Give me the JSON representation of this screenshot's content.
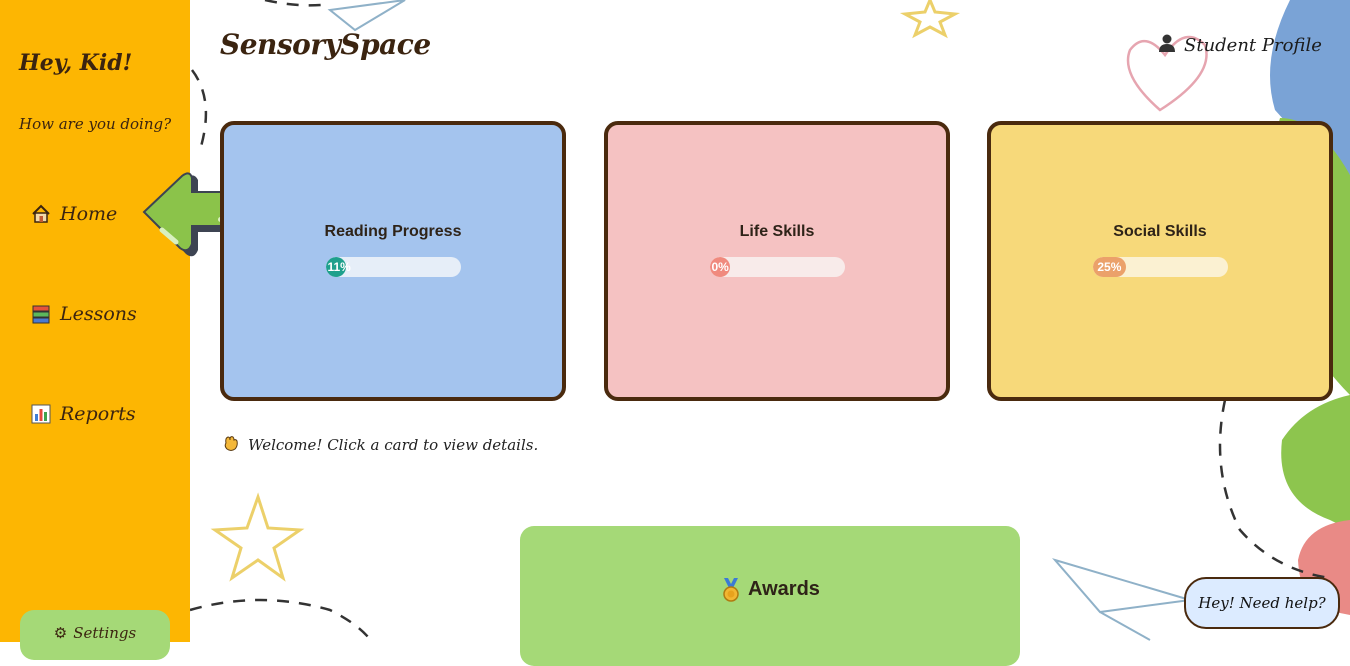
{
  "sidebar": {
    "greeting": "Hey, Kid!",
    "subgreeting": "How are you doing?",
    "nav": [
      {
        "label": "Home",
        "icon": "house-icon"
      },
      {
        "label": "Lessons",
        "icon": "books-icon"
      },
      {
        "label": "Reports",
        "icon": "bar-chart-icon"
      }
    ],
    "settings_label": "Settings",
    "settings_icon": "gear-icon"
  },
  "header": {
    "brand": "SensorySpace",
    "profile_label": "Student Profile",
    "profile_icon": "person-silhouette-icon"
  },
  "cards": [
    {
      "title": "Reading Progress",
      "progress_label": "11%",
      "progress_value": 0.11,
      "color": "#a4c4ee",
      "bar_track": "#e6eef8",
      "bar_fill": "#1ea08c"
    },
    {
      "title": "Life Skills",
      "progress_label": "0%",
      "progress_value": 0.0,
      "color": "#f5c2c2",
      "bar_track": "#f8ebea",
      "bar_fill": "#f08a7e"
    },
    {
      "title": "Social Skills",
      "progress_label": "25%",
      "progress_value": 0.25,
      "color": "#f7d97a",
      "bar_track": "#fbf1d2",
      "bar_fill": "#eba16a"
    }
  ],
  "welcome": {
    "text": "Welcome! Click a card to view details.",
    "icon": "waving-hand-icon"
  },
  "awards": {
    "title": "Awards",
    "icon": "medal-icon"
  },
  "help": {
    "label": "Hey! Need help?"
  },
  "colors": {
    "sidebar": "#fdb602",
    "accent_green": "#a5d977",
    "border_brown": "#4a2a0e"
  }
}
